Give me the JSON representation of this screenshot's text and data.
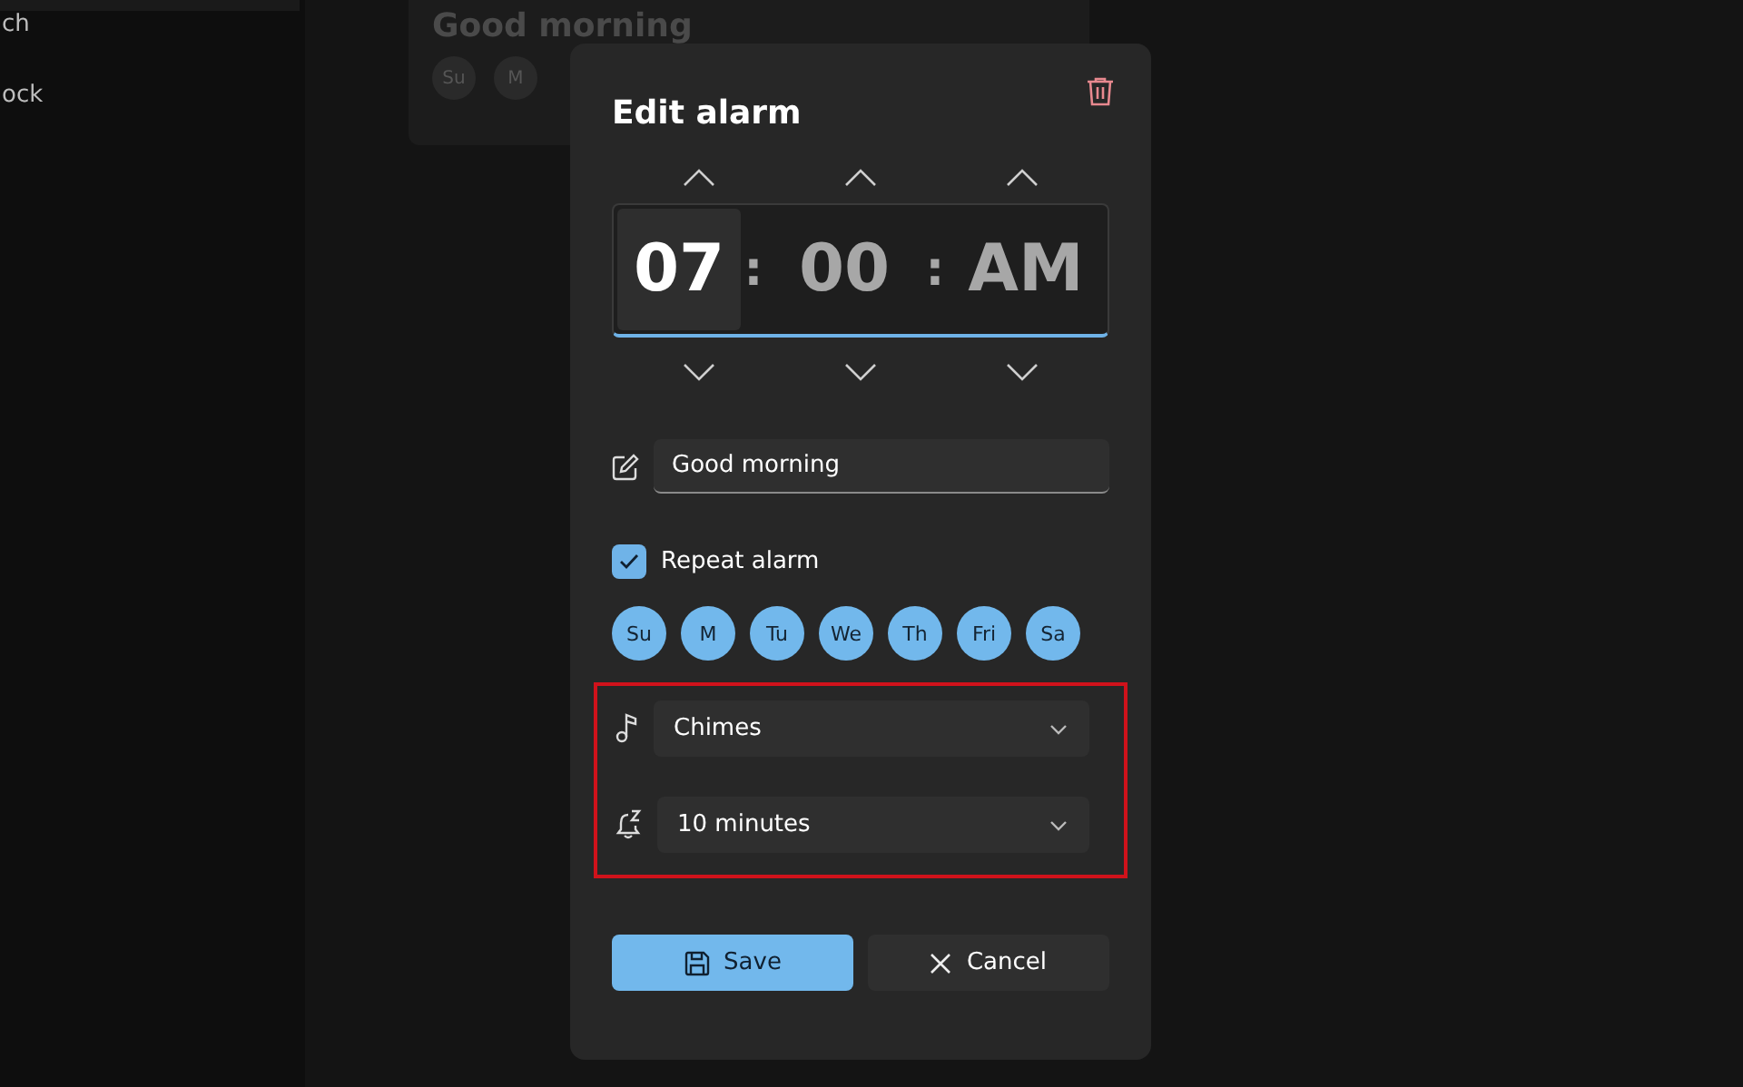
{
  "sidebar": {
    "items": [
      {
        "label": "ch"
      },
      {
        "label": "ock"
      }
    ]
  },
  "alarm_card": {
    "title": "Good morning",
    "days": [
      {
        "label": "Su"
      },
      {
        "label": "M"
      }
    ]
  },
  "dialog": {
    "title": "Edit alarm",
    "time": [
      {
        "kind": "segment",
        "value": "07",
        "selected": true
      },
      {
        "kind": "separator",
        "value": ":"
      },
      {
        "kind": "segment",
        "value": "00",
        "selected": false
      },
      {
        "kind": "separator",
        "value": ":"
      },
      {
        "kind": "segment",
        "value": "AM",
        "selected": false
      }
    ],
    "name_field": {
      "value": "Good morning"
    },
    "repeat": {
      "label": "Repeat alarm",
      "checked": true
    },
    "days": [
      {
        "label": "Su",
        "selected": true
      },
      {
        "label": "M",
        "selected": true
      },
      {
        "label": "Tu",
        "selected": true
      },
      {
        "label": "We",
        "selected": true
      },
      {
        "label": "Th",
        "selected": true
      },
      {
        "label": "Fri",
        "selected": true
      },
      {
        "label": "Sa",
        "selected": true
      }
    ],
    "highlighted": true,
    "sound": {
      "value": "Chimes"
    },
    "snooze": {
      "value": "10 minutes"
    },
    "buttons": [
      {
        "kind": "save",
        "label": "Save"
      },
      {
        "kind": "cancel",
        "label": "Cancel"
      }
    ]
  }
}
